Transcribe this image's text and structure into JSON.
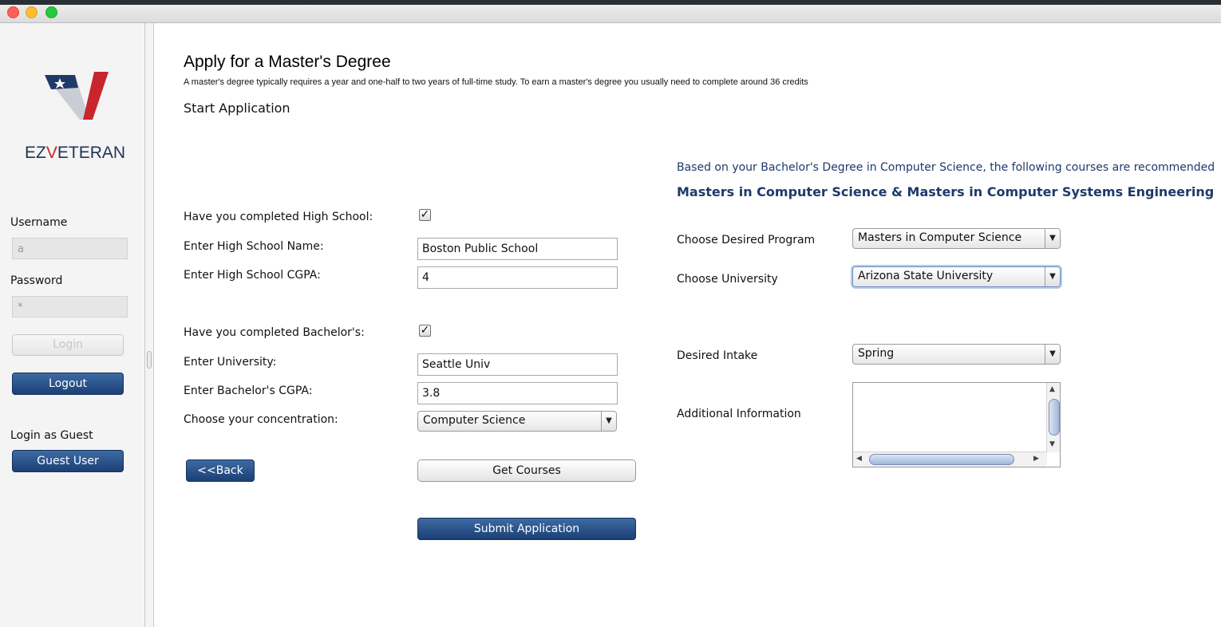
{
  "window": {
    "title": ""
  },
  "sidebar": {
    "brand_left": "EZ",
    "brand_v": "V",
    "brand_right": "ETERAN",
    "username_label": "Username",
    "username_value": "a",
    "password_label": "Password",
    "password_value": "*",
    "login_label": "Login",
    "logout_label": "Logout",
    "guest_heading": "Login as Guest",
    "guest_button": "Guest User"
  },
  "header": {
    "title": "Apply for a Master's Degree",
    "description": "A master's degree typically requires a year and one-half to two years of full-time study. To earn a master's degree you usually need to complete around 36 credits",
    "section": "Start Application"
  },
  "form": {
    "high_school_done_label": "Have you completed High School:",
    "high_school_done": true,
    "high_school_name_label": "Enter High School Name:",
    "high_school_name": "Boston Public School",
    "high_school_cgpa_label": "Enter High School CGPA:",
    "high_school_cgpa": "4",
    "bachelors_done_label": "Have you completed Bachelor's:",
    "bachelors_done": true,
    "university_label": "Enter University:",
    "university": "Seattle Univ",
    "bachelors_cgpa_label": "Enter Bachelor's CGPA:",
    "bachelors_cgpa": "3.8",
    "concentration_label": "Choose your concentration:",
    "concentration": "Computer Science",
    "back_button": "<<Back",
    "get_courses_button": "Get Courses",
    "submit_button": "Submit Application"
  },
  "recommendation": {
    "intro": "Based on your Bachelor's Degree in Computer Science, the following courses are recommended",
    "programs": "Masters in Computer Science & Masters in Computer Systems Engineering",
    "program_label": "Choose Desired Program",
    "program": "Masters in Computer Science",
    "university_label": "Choose University",
    "university": "Arizona State University",
    "intake_label": "Desired Intake",
    "intake": "Spring",
    "additional_label": "Additional Information",
    "additional_value": ""
  },
  "icons": {
    "checkmark": "✓",
    "dropdown": "▼"
  },
  "colors": {
    "accent_blue": "#1c4075",
    "heading_navy": "#1e3a6b",
    "logo_red": "#c8262c"
  }
}
